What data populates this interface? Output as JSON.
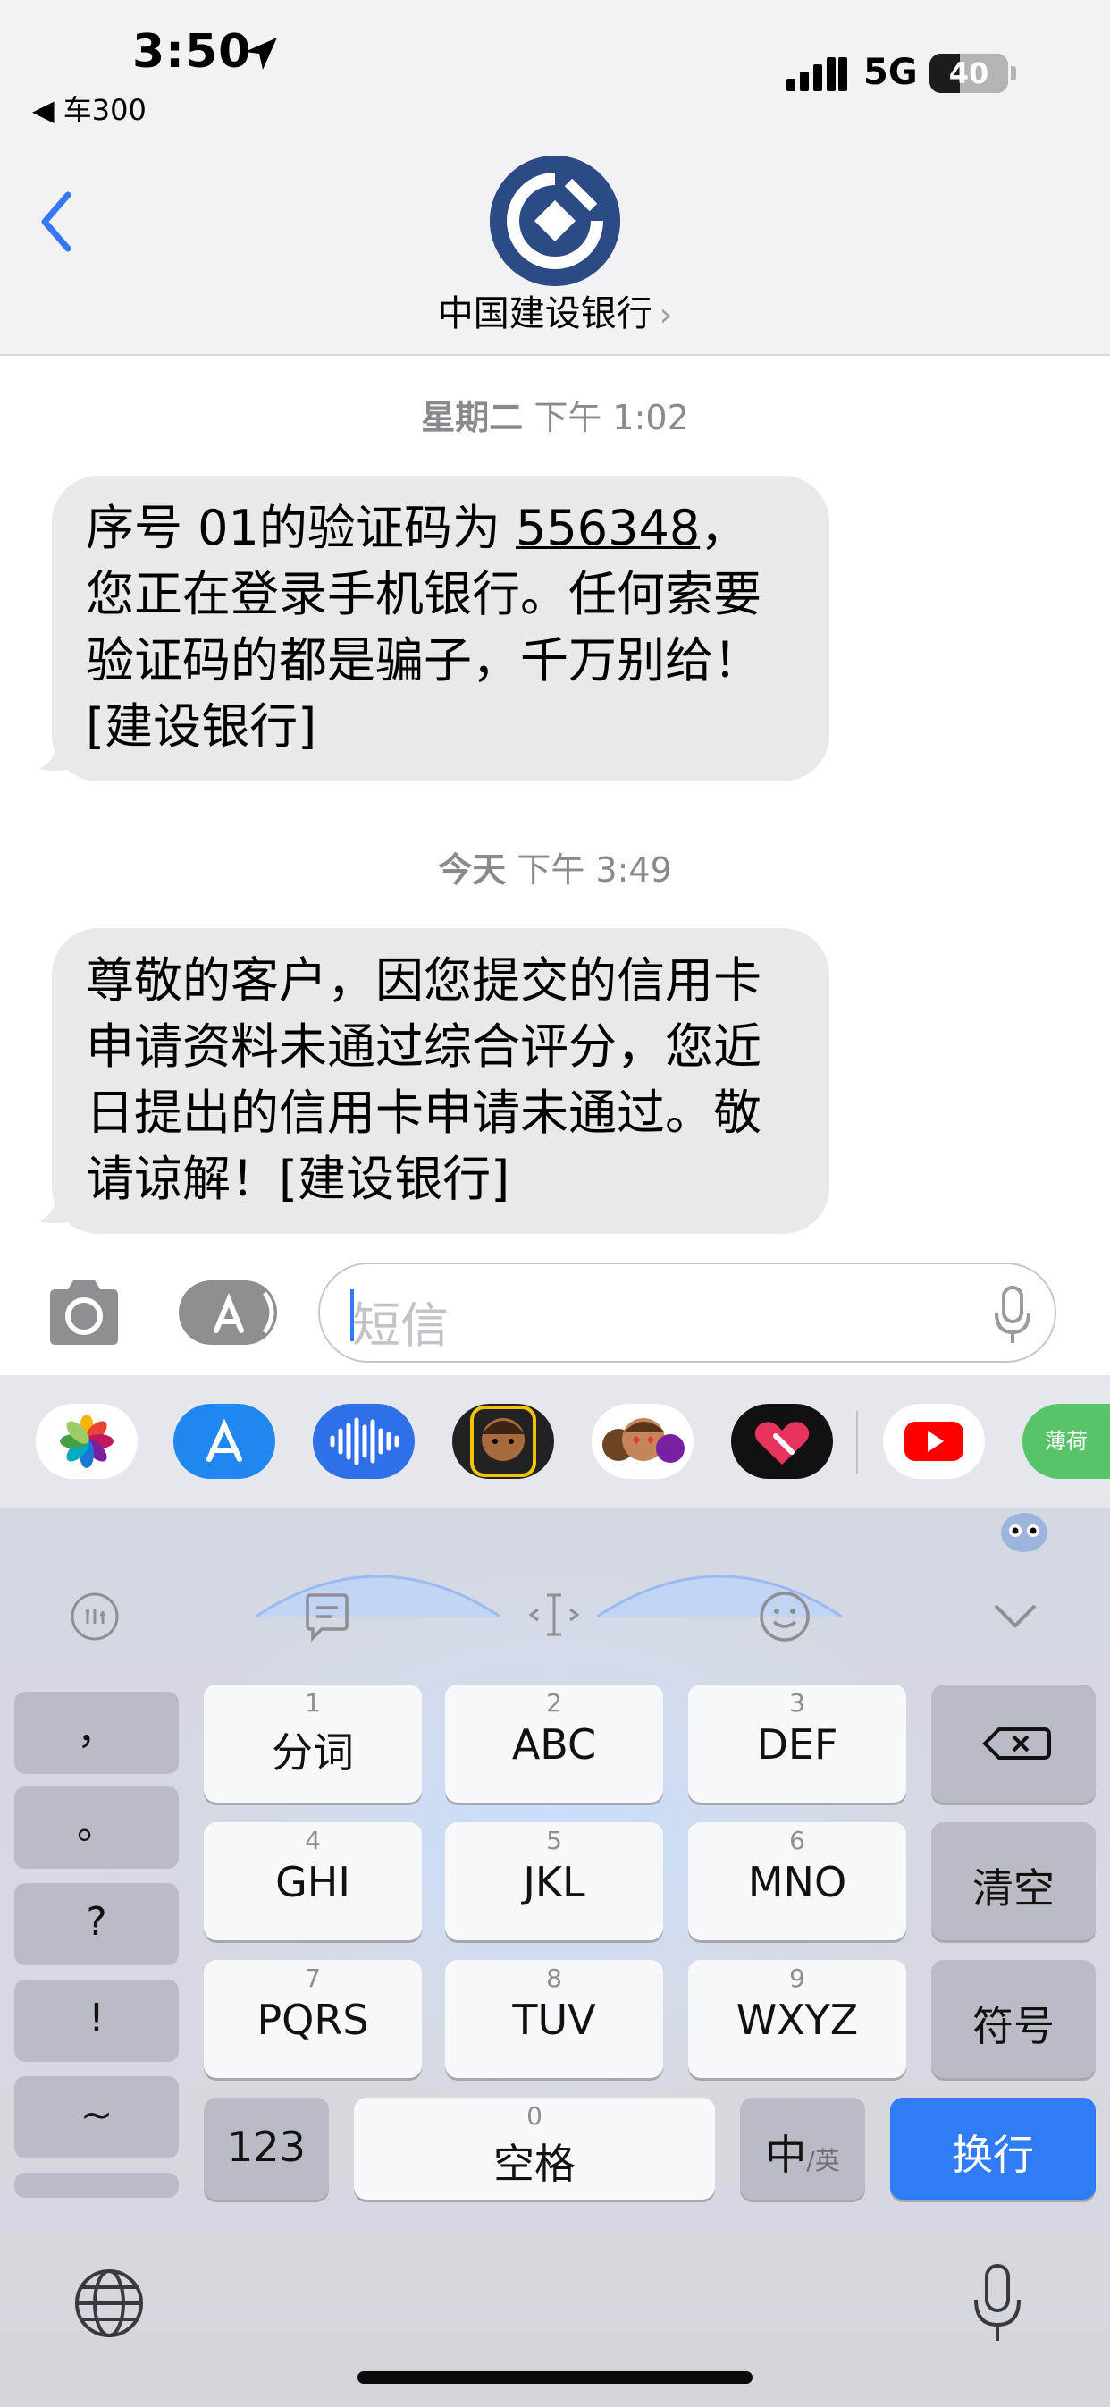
{
  "status_bar": {
    "time": "3:50",
    "back_app": "◀ 车300",
    "network": "5G",
    "battery": "40"
  },
  "contact": {
    "name": "中国建设银行",
    "chevron": "›"
  },
  "messages": [
    {
      "timestamp_day": "星期二",
      "timestamp_time": "下午 1:02",
      "text_before": "序号 01的验证码为 ",
      "code": "556348",
      "text_after": "，您正在登录手机银行。任何索要验证码的都是骗子，千万别给！[建设银行]"
    },
    {
      "timestamp_day": "今天",
      "timestamp_time": "下午 3:49",
      "text": "尊敬的客户，因您提交的信用卡申请资料未通过综合评分，您近日提出的信用卡申请未通过。敬请谅解！[建设银行]"
    }
  ],
  "compose": {
    "placeholder": "短信"
  },
  "app_strip": {
    "icons": [
      "photos-icon",
      "app-store-icon",
      "audio-message-icon",
      "memoji-icon",
      "memoji-stickers-icon",
      "digital-touch-icon",
      "youtube-icon",
      "boohee-icon"
    ],
    "last_label": "薄荷"
  },
  "keyboard": {
    "punctuation": [
      "，",
      "。",
      "?",
      "!",
      "~"
    ],
    "keys": [
      {
        "num": "1",
        "label": "分词"
      },
      {
        "num": "2",
        "label": "ABC"
      },
      {
        "num": "3",
        "label": "DEF"
      },
      {
        "num": "4",
        "label": "GHI"
      },
      {
        "num": "5",
        "label": "JKL"
      },
      {
        "num": "6",
        "label": "MNO"
      },
      {
        "num": "7",
        "label": "PQRS"
      },
      {
        "num": "8",
        "label": "TUV"
      },
      {
        "num": "9",
        "label": "WXYZ"
      }
    ],
    "clear": "清空",
    "symbols": "符号",
    "numbers": "123",
    "space_num": "0",
    "space": "空格",
    "lang_main": "中",
    "lang_sub": "/英",
    "return": "换行"
  },
  "colors": {
    "accent": "#3478f6",
    "bank_blue": "#2c4a86",
    "bubble": "#e9e9eb",
    "return_key": "#2f7cf6"
  }
}
